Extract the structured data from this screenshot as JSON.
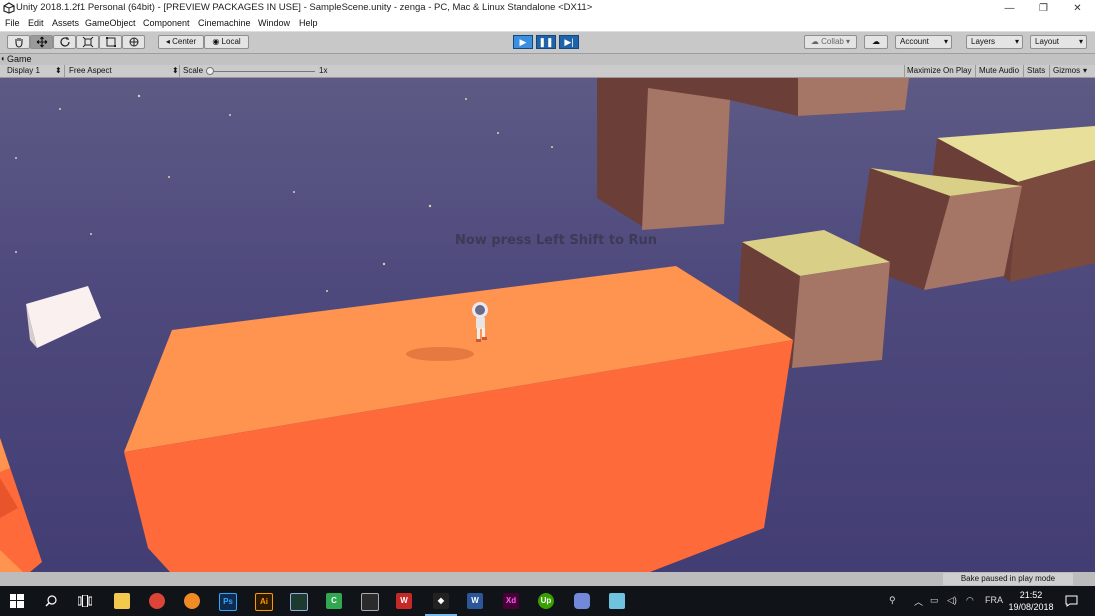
{
  "window": {
    "title": "Unity 2018.1.2f1 Personal (64bit) - [PREVIEW PACKAGES IN USE] - SampleScene.unity - zenga - PC, Mac & Linux Standalone <DX11>",
    "minimize": "—",
    "restore": "❐",
    "close": "✕"
  },
  "menu": [
    "File",
    "Edit",
    "Assets",
    "GameObject",
    "Component",
    "Cinemachine",
    "Window",
    "Help"
  ],
  "toolbar": {
    "tools": [
      "hand-tool",
      "move-tool",
      "rotate-tool",
      "scale-tool",
      "rect-tool",
      "transform-tool"
    ],
    "pivot_mode": "Center",
    "pivot_rotation": "Local",
    "collab": "Collab ▾",
    "account": "Account",
    "layers": "Layers",
    "layout": "Layout",
    "dropdown_arrow": "▾"
  },
  "game_tab": {
    "label": "Game",
    "display": "Display 1",
    "aspect": "Free Aspect",
    "scale_label": "Scale",
    "scale_value": "1x",
    "maximize_on_play": "Maximize On Play",
    "mute_audio": "Mute Audio",
    "stats": "Stats",
    "gizmos": "Gizmos"
  },
  "game": {
    "hint_text": "Now press Left Shift to Run"
  },
  "status": {
    "message": "Bake paused in play mode"
  },
  "taskbar": {
    "apps": [
      "file-explorer-icon",
      "chrome-icon",
      "blender-icon",
      "photoshop-icon",
      "illustrator-icon",
      "media-player-icon",
      "camtasia-icon",
      "unity-hub-icon",
      "winrar-icon",
      "unity-icon",
      "word-icon",
      "xd-icon",
      "upwork-icon",
      "discord-icon",
      "notepad-icon"
    ],
    "language": "FRA",
    "time": "21:52",
    "date": "19/08/2018"
  },
  "colors": {
    "sky": "#4f4a7d",
    "platform_top": "#ff9350",
    "platform_front": "#ff6a3a",
    "block_side": "#7a4a3e",
    "block_top": "#e8df9a",
    "play_accent": "#3b8fe0"
  }
}
